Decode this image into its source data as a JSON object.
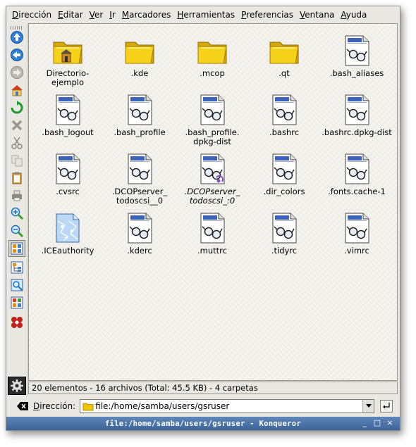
{
  "menubar": {
    "items": [
      {
        "label": "Dirección",
        "access": "D",
        "rest": "irección"
      },
      {
        "label": "Editar",
        "access": "E",
        "rest": "ditar"
      },
      {
        "label": "Ver",
        "access": "V",
        "rest": "er"
      },
      {
        "label": "Ir",
        "access": "I",
        "rest": "r"
      },
      {
        "label": "Marcadores",
        "access": "M",
        "rest": "arcadores"
      },
      {
        "label": "Herramientas",
        "access": "H",
        "rest": "erramientas"
      },
      {
        "label": "Preferencias",
        "access": "P",
        "rest": "referencias"
      },
      {
        "label": "Ventana",
        "access": "V",
        "rest": "entana"
      },
      {
        "label": "Ayuda",
        "access": "A",
        "rest": "yuda"
      }
    ]
  },
  "toolbar": {
    "buttons": [
      {
        "icon": "up-arrow-icon"
      },
      {
        "icon": "back-arrow-icon"
      },
      {
        "icon": "forward-arrow-icon"
      },
      {
        "icon": "home-icon"
      },
      {
        "icon": "reload-icon"
      },
      {
        "icon": "stop-icon"
      },
      {
        "icon": "cut-icon"
      },
      {
        "icon": "copy-icon"
      },
      {
        "icon": "paste-icon"
      },
      {
        "icon": "print-icon"
      },
      {
        "icon": "zoom-in-icon"
      },
      {
        "icon": "zoom-out-icon"
      },
      {
        "icon": "icon-view-icon"
      },
      {
        "icon": "tree-view-icon"
      },
      {
        "icon": "preview-icon"
      },
      {
        "icon": "multicolumn-view-icon"
      },
      {
        "icon": "konqueror-gear-icon"
      }
    ]
  },
  "files": [
    {
      "name": "Directorio-\nejemplo",
      "type": "folder-home"
    },
    {
      "name": ".kde",
      "type": "folder"
    },
    {
      "name": ".mcop",
      "type": "folder"
    },
    {
      "name": ".qt",
      "type": "folder"
    },
    {
      "name": ".bash_aliases",
      "type": "file"
    },
    {
      "name": ".bash_logout",
      "type": "file"
    },
    {
      "name": ".bash_profile",
      "type": "file"
    },
    {
      "name": ".bash_profile.\ndpkg-dist",
      "type": "file"
    },
    {
      "name": ".bashrc",
      "type": "file"
    },
    {
      "name": ".bashrc.dpkg-dist",
      "type": "file"
    },
    {
      "name": ".cvsrc",
      "type": "file"
    },
    {
      "name": ".DCOPserver_\ntodoscsi__0",
      "type": "file"
    },
    {
      "name": ".DCOPserver_\ntodoscsi_:0",
      "type": "link",
      "italic": true
    },
    {
      "name": ".dir_colors",
      "type": "file"
    },
    {
      "name": ".fonts.cache-1",
      "type": "file"
    },
    {
      "name": ".ICEauthority",
      "type": "ice"
    },
    {
      "name": ".kderc",
      "type": "file"
    },
    {
      "name": ".muttrc",
      "type": "file"
    },
    {
      "name": ".tidyrc",
      "type": "file"
    },
    {
      "name": ".vimrc",
      "type": "file"
    }
  ],
  "status": {
    "text": "20 elementos - 16 archivos (Total: 45.5 KB) - 4 carpetas"
  },
  "location": {
    "label_access": "D",
    "label_rest": "irección:",
    "value": "file:/home/samba/users/gsruser"
  },
  "titlebar": {
    "title": "file:/home/samba/users/gsruser - Konqueror",
    "minimize": "_",
    "maximize": "□",
    "close": "×"
  },
  "colors": {
    "titlebar": "#4a72a8",
    "folder": "#f2c500",
    "window_bg": "#eae8e3"
  }
}
